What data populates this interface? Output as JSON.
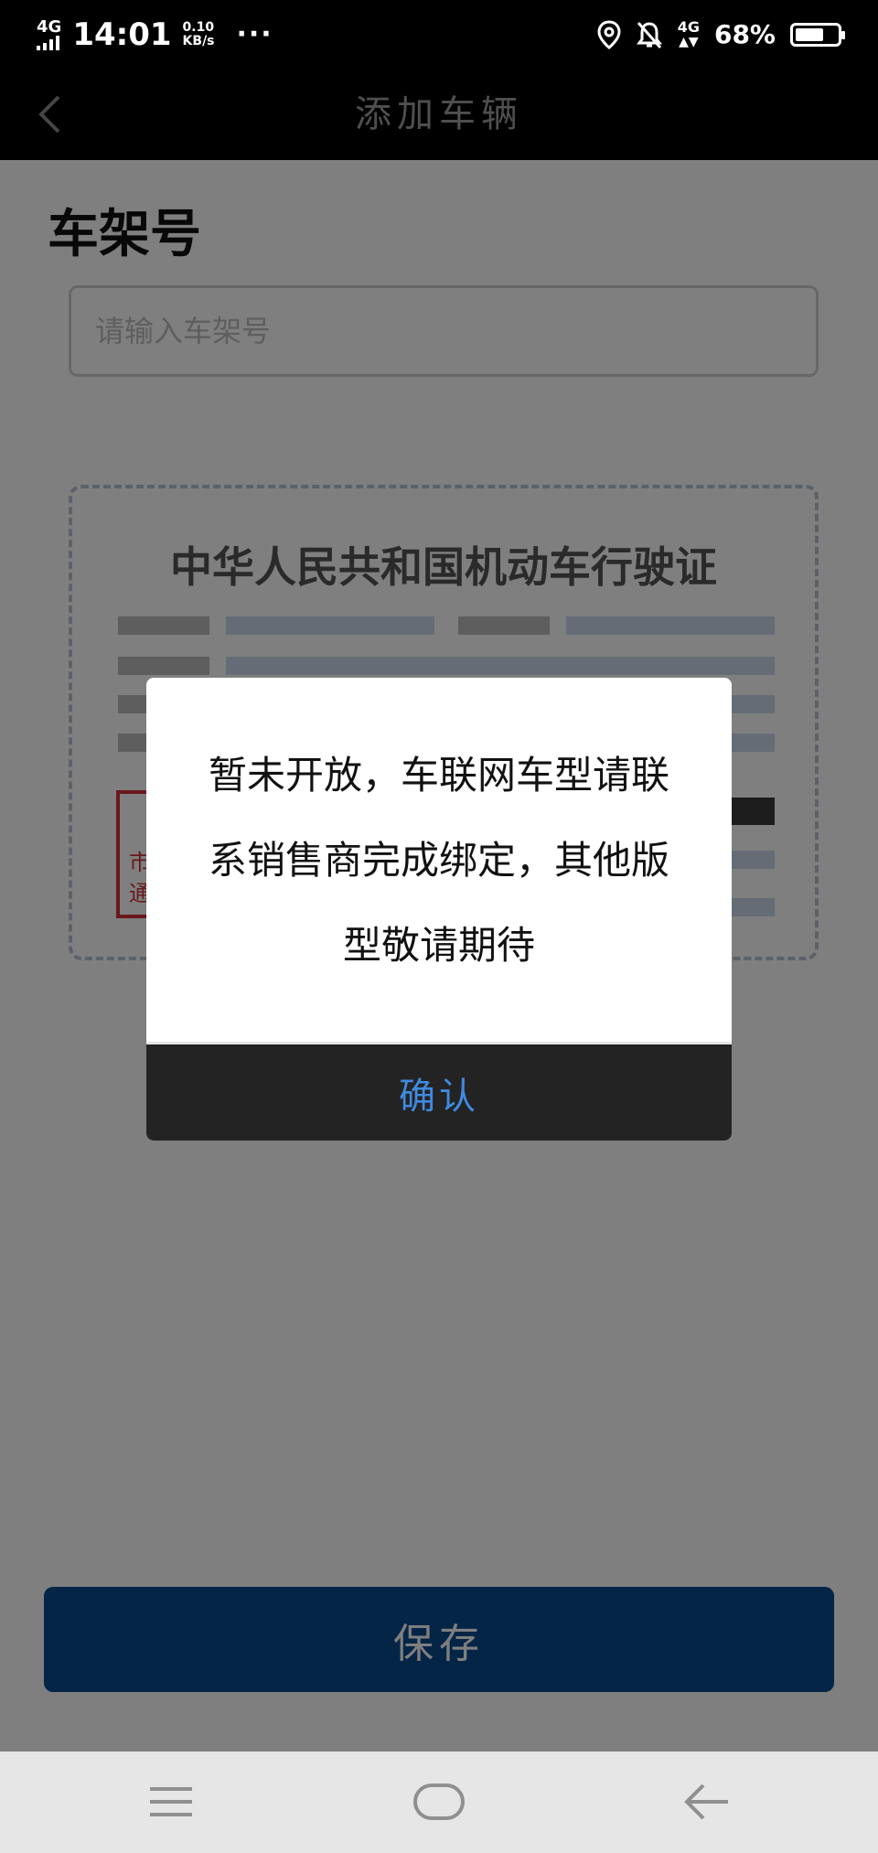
{
  "status_bar": {
    "network_top": "4G",
    "time": "14:01",
    "speed_value": "0.10",
    "speed_unit": "KB/s",
    "more": "···",
    "network_right": "4G",
    "battery": "68%",
    "battery_level": 0.68,
    "icons": [
      "signal-icon",
      "location-icon",
      "bell-muted-icon",
      "data-arrows-icon",
      "battery-icon"
    ]
  },
  "nav": {
    "title": "添加车辆",
    "back_icon": "chevron-left-icon"
  },
  "form": {
    "section_title": "车架号",
    "vin_placeholder": "请输入车架号",
    "card_title": "中华人民共和国机动车行驶证",
    "stamp_line1": "市",
    "stamp_line2": "通"
  },
  "save_button": "保存",
  "dialog": {
    "message": "暂未开放，车联网车型请联系销售商完成绑定，其他版型敬请期待",
    "confirm": "确认"
  },
  "system_nav": [
    "menu-icon",
    "home-icon",
    "back-arrow-icon"
  ],
  "colors": {
    "accent": "#3f8ae0",
    "save_button": "#0a4a8f",
    "stamp": "#d3303a"
  }
}
